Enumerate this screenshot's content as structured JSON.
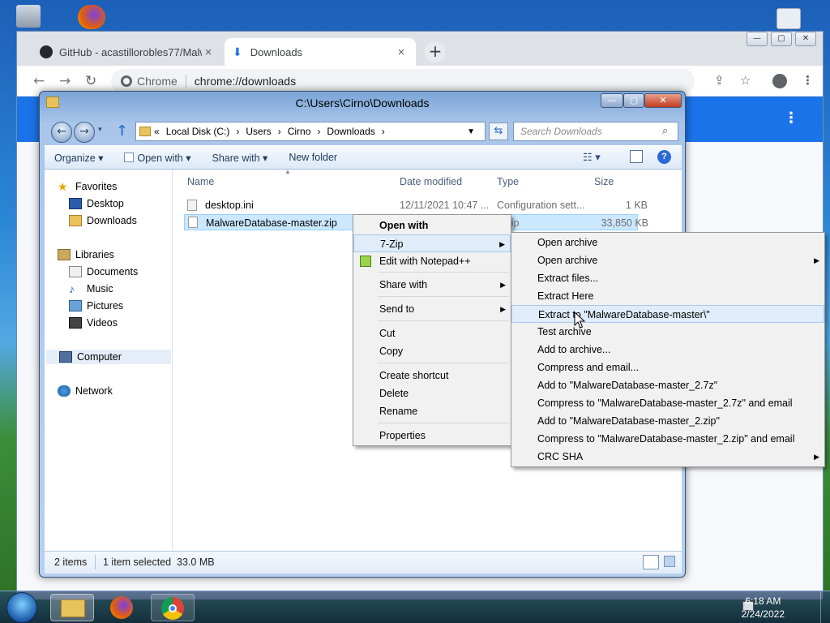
{
  "chrome": {
    "tabs": [
      {
        "title": "GitHub - acastillorobles77/Malw",
        "close": "×"
      },
      {
        "title": "Downloads",
        "close": "×"
      }
    ],
    "new_tab": "+",
    "omnibox": {
      "chip": "Chrome",
      "url": "chrome://downloads"
    },
    "window_buttons": [
      "—",
      "▢",
      "✕"
    ]
  },
  "explorer": {
    "title": "C:\\Users\\Cirno\\Downloads",
    "breadcrumb": [
      "«",
      "Local Disk (C:)",
      "›",
      "Users",
      "›",
      "Cirno",
      "›",
      "Downloads",
      "›"
    ],
    "search_placeholder": "Search Downloads",
    "commands": {
      "organize": "Organize ▾",
      "open_with": "Open with ▾",
      "share_with": "Share with ▾",
      "new_folder": "New folder"
    },
    "nav": {
      "favorites": "Favorites",
      "desktop": "Desktop",
      "downloads": "Downloads",
      "libraries": "Libraries",
      "documents": "Documents",
      "music": "Music",
      "pictures": "Pictures",
      "videos": "Videos",
      "computer": "Computer",
      "network": "Network"
    },
    "columns": {
      "name": "Name",
      "date": "Date modified",
      "type": "Type",
      "size": "Size"
    },
    "files": [
      {
        "name": "desktop.ini",
        "date": "12/11/2021 10:47 ...",
        "type": "Configuration sett...",
        "size": "1 KB"
      },
      {
        "name": "MalwareDatabase-master.zip",
        "date": "",
        "type": "p.zip",
        "size": "33,850 KB"
      }
    ],
    "status": {
      "items": "2 items",
      "selected": "1 item selected  33.0 MB"
    }
  },
  "context_menu": {
    "items": [
      "Open with",
      "7-Zip",
      "Edit with Notepad++",
      "Share with",
      "Send to",
      "Cut",
      "Copy",
      "Create shortcut",
      "Delete",
      "Rename",
      "Properties"
    ]
  },
  "zip_menu": {
    "items": [
      "Open archive",
      "Open archive",
      "Extract files...",
      "Extract Here",
      "Extract to \"MalwareDatabase-master\\\"",
      "Test archive",
      "Add to archive...",
      "Compress and email...",
      "Add to \"MalwareDatabase-master_2.7z\"",
      "Compress to \"MalwareDatabase-master_2.7z\" and email",
      "Add to \"MalwareDatabase-master_2.zip\"",
      "Compress to \"MalwareDatabase-master_2.zip\" and email",
      "CRC SHA"
    ]
  },
  "taskbar": {
    "time": "6:18 AM",
    "date": "2/24/2022"
  },
  "colors": {
    "chrome_blue": "#1a73e8",
    "selection": "#cce8ff",
    "menu_highlight": "#e0ecf9"
  }
}
